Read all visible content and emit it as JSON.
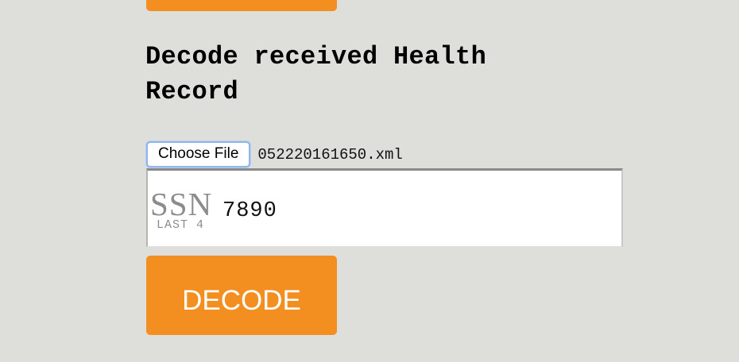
{
  "section": {
    "title": "Decode received Health Record"
  },
  "file_input": {
    "button_label": "Choose File",
    "file_name": "052220161650.xml"
  },
  "ssn": {
    "label": "SSN",
    "sublabel": "LAST 4",
    "value": "7890"
  },
  "decode_button": {
    "label": "DECODE"
  },
  "colors": {
    "accent_orange": "#f38e20",
    "background": "#dededa",
    "label_gray": "#8c8c8c",
    "focus_blue": "#8fb6e8"
  }
}
